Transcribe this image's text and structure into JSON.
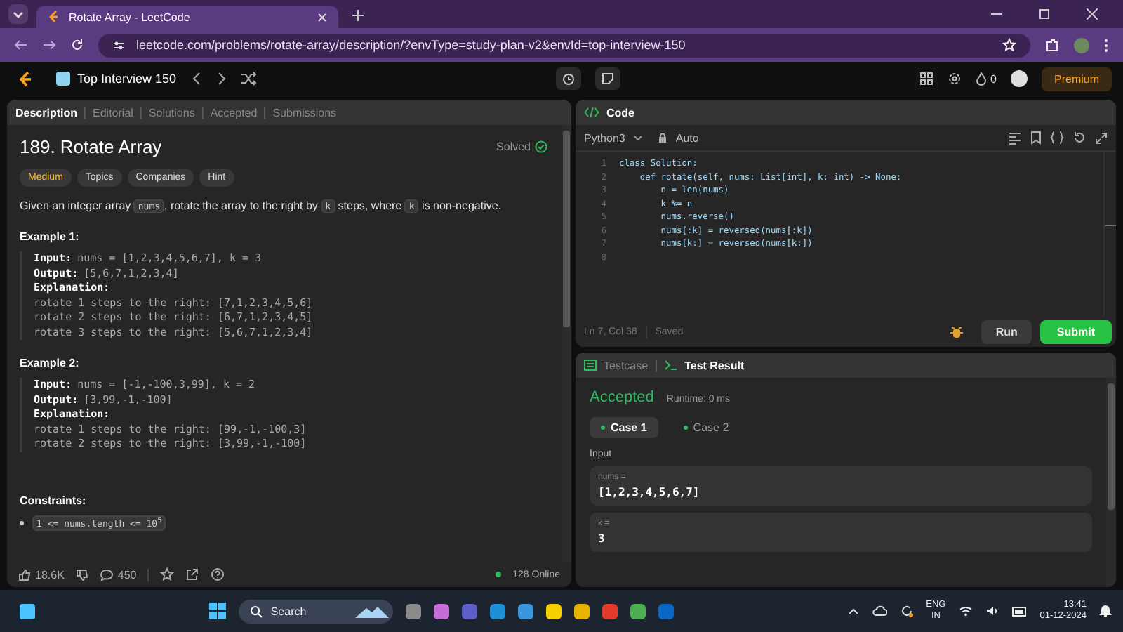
{
  "browser": {
    "tab_title": "Rotate Array - LeetCode",
    "url": "leetcode.com/problems/rotate-array/description/?envType=study-plan-v2&envId=top-interview-150"
  },
  "nav": {
    "study_plan": "Top Interview 150",
    "streak": "0",
    "premium": "Premium"
  },
  "left_tabs": [
    {
      "label": "Description",
      "selected": true
    },
    {
      "label": "Editorial",
      "selected": false
    },
    {
      "label": "Solutions",
      "selected": false
    },
    {
      "label": "Accepted",
      "selected": false
    },
    {
      "label": "Submissions",
      "selected": false
    }
  ],
  "problem": {
    "title": "189. Rotate Array",
    "status": "Solved",
    "difficulty": "Medium",
    "tags": [
      "Topics",
      "Companies",
      "Hint"
    ],
    "statement": [
      {
        "kind": "text",
        "text": "Given an integer array "
      },
      {
        "kind": "code",
        "text": "nums"
      },
      {
        "kind": "text",
        "text": ", rotate the array to the right by "
      },
      {
        "kind": "code",
        "text": "k"
      },
      {
        "kind": "text",
        "text": " steps, where "
      },
      {
        "kind": "code",
        "text": "k"
      },
      {
        "kind": "text",
        "text": " is non-negative."
      }
    ],
    "examples": [
      {
        "heading": "Example 1:",
        "fields": [
          {
            "label": "Input:",
            "value": "nums = [1,2,3,4,5,6,7], k = 3"
          },
          {
            "label": "Output:",
            "value": "[5,6,7,1,2,3,4]"
          },
          {
            "label": "Explanation:"
          }
        ],
        "explanation": [
          "rotate 1 steps to the right: [7,1,2,3,4,5,6]",
          "rotate 2 steps to the right: [6,7,1,2,3,4,5]",
          "rotate 3 steps to the right: [5,6,7,1,2,3,4]"
        ]
      },
      {
        "heading": "Example 2:",
        "fields": [
          {
            "label": "Input:",
            "value": "nums = [-1,-100,3,99], k = 2"
          },
          {
            "label": "Output:",
            "value": "[3,99,-1,-100]"
          },
          {
            "label": "Explanation:"
          }
        ],
        "explanation": [
          "rotate 1 steps to the right: [99,-1,-100,3]",
          "rotate 2 steps to the right: [3,99,-1,-100]"
        ]
      }
    ],
    "constraints_heading": "Constraints:",
    "constraints": [
      "1 <= nums.length <= 10$^{5}$"
    ]
  },
  "footer": {
    "likes": "18.6K",
    "comments": "450",
    "online": "128 Online"
  },
  "code": {
    "title": "Code",
    "language": "Python3",
    "mode": "Auto",
    "lines": [
      {
        "number": "1",
        "code": "class Solution:"
      },
      {
        "number": "2",
        "code": "    def rotate(self, nums: List[int], k: int) -> None:"
      },
      {
        "number": "3",
        "code": "        n = len(nums)"
      },
      {
        "number": "4",
        "code": "        k %= n"
      },
      {
        "number": "5",
        "code": "        nums.reverse()"
      },
      {
        "number": "6",
        "code": "        nums[:k] = reversed(nums[:k])"
      },
      {
        "number": "7",
        "code": "        nums[k:] = reversed(nums[k:])"
      },
      {
        "number": "8"
      }
    ],
    "cursor": "Ln 7, Col 38",
    "save_state": "Saved",
    "run": "Run",
    "submit": "Submit"
  },
  "result": {
    "tabs": [
      {
        "label": "Testcase",
        "selected": false
      },
      {
        "label": "Test Result",
        "selected": true
      }
    ],
    "verdict": "Accepted",
    "runtime": "Runtime: 0 ms",
    "cases": [
      {
        "label": "Case 1",
        "selected": true
      },
      {
        "label": "Case 2",
        "selected": false
      }
    ],
    "input_label": "Input",
    "params": [
      {
        "name": "nums =",
        "value": "[1,2,3,4,5,6,7]"
      },
      {
        "name": "k =",
        "value": "3"
      }
    ]
  },
  "taskbar": {
    "search": "Search",
    "language": "ENG",
    "region": "IN",
    "time": "13:41",
    "date": "01-12-2024"
  }
}
